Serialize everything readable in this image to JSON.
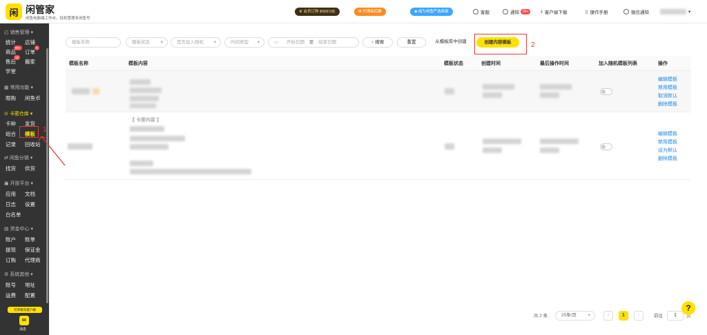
{
  "app": {
    "logo_glyph": "闲",
    "name": "闲管家",
    "slogan": "闲鱼电脑端工作台，轻松管理多闲鱼号"
  },
  "topbar": {
    "member": "会员订购",
    "member_note": "解锁新功能",
    "agent": "代理商招募",
    "partner": "成为闲鱼严选商家",
    "service": "客服",
    "notify": "通知",
    "notify_badge": "99+",
    "download": "客户端下载",
    "manual": "操作手册",
    "wechat": "微信通知"
  },
  "sidebar": {
    "sections": [
      {
        "title": "销售管理",
        "items": [
          "统计",
          "店铺",
          "商品",
          "订单",
          "售后",
          "搬家",
          "学堂"
        ]
      },
      {
        "title": "常用功能",
        "items": [
          "限购",
          "闲鱼币"
        ]
      },
      {
        "title": "卡密仓库",
        "items": [
          "卡种",
          "发货",
          "组合",
          "模板",
          "记录",
          "回收站"
        ]
      },
      {
        "title": "闲鱼分销",
        "items": [
          "找货",
          "供货"
        ]
      },
      {
        "title": "开放平台",
        "items": [
          "应用",
          "文档",
          "日志",
          "设置",
          "白名单"
        ]
      },
      {
        "title": "资金中心",
        "items": [
          "账户",
          "账单",
          "提现",
          "保证金",
          "订购",
          "代理商"
        ]
      },
      {
        "title": "系统其他",
        "items": [
          "账号",
          "地址",
          "运费",
          "配置"
        ]
      }
    ],
    "badges": {
      "goods": "99+",
      "orders": "9",
      "aftersale": "10"
    },
    "bottom_banner": "打开聊天客户端",
    "bottom_label": "消息"
  },
  "annotations": {
    "mark1": "1",
    "mark2": "2"
  },
  "filters": {
    "name_placeholder": "模板名称",
    "status_placeholder": "模板状态",
    "random_placeholder": "是否加入随机",
    "time_type_placeholder": "时间类型",
    "start_placeholder": "开始日期",
    "range_sep": "至",
    "end_placeholder": "结束日期",
    "search_btn": "搜索",
    "reset_btn": "重置",
    "from_lib_btn": "从模板库中创建",
    "create_btn": "创建内容模板"
  },
  "table": {
    "headers": [
      "模板名称",
      "模板内容",
      "模板状态",
      "创建时间",
      "最后操作时间",
      "加入随机模板列表",
      "操作"
    ],
    "rows": [
      {
        "actions": [
          "编辑模板",
          "禁用模板",
          "取消默认",
          "删除模板"
        ]
      },
      {
        "content_prefix": "【 卡密内容 】",
        "actions": [
          "编辑模板",
          "禁用模板",
          "设为默认",
          "删除模板"
        ]
      }
    ]
  },
  "pagination": {
    "total": "共 2 条",
    "page_size": "25条/页",
    "current": "1",
    "goto_label": "前往",
    "goto_value": "1",
    "page_unit": "页"
  },
  "colors": {
    "accent": "#ffe100",
    "link": "#1e88e5",
    "annotation": "#e53935",
    "sidebar": "#333333"
  }
}
